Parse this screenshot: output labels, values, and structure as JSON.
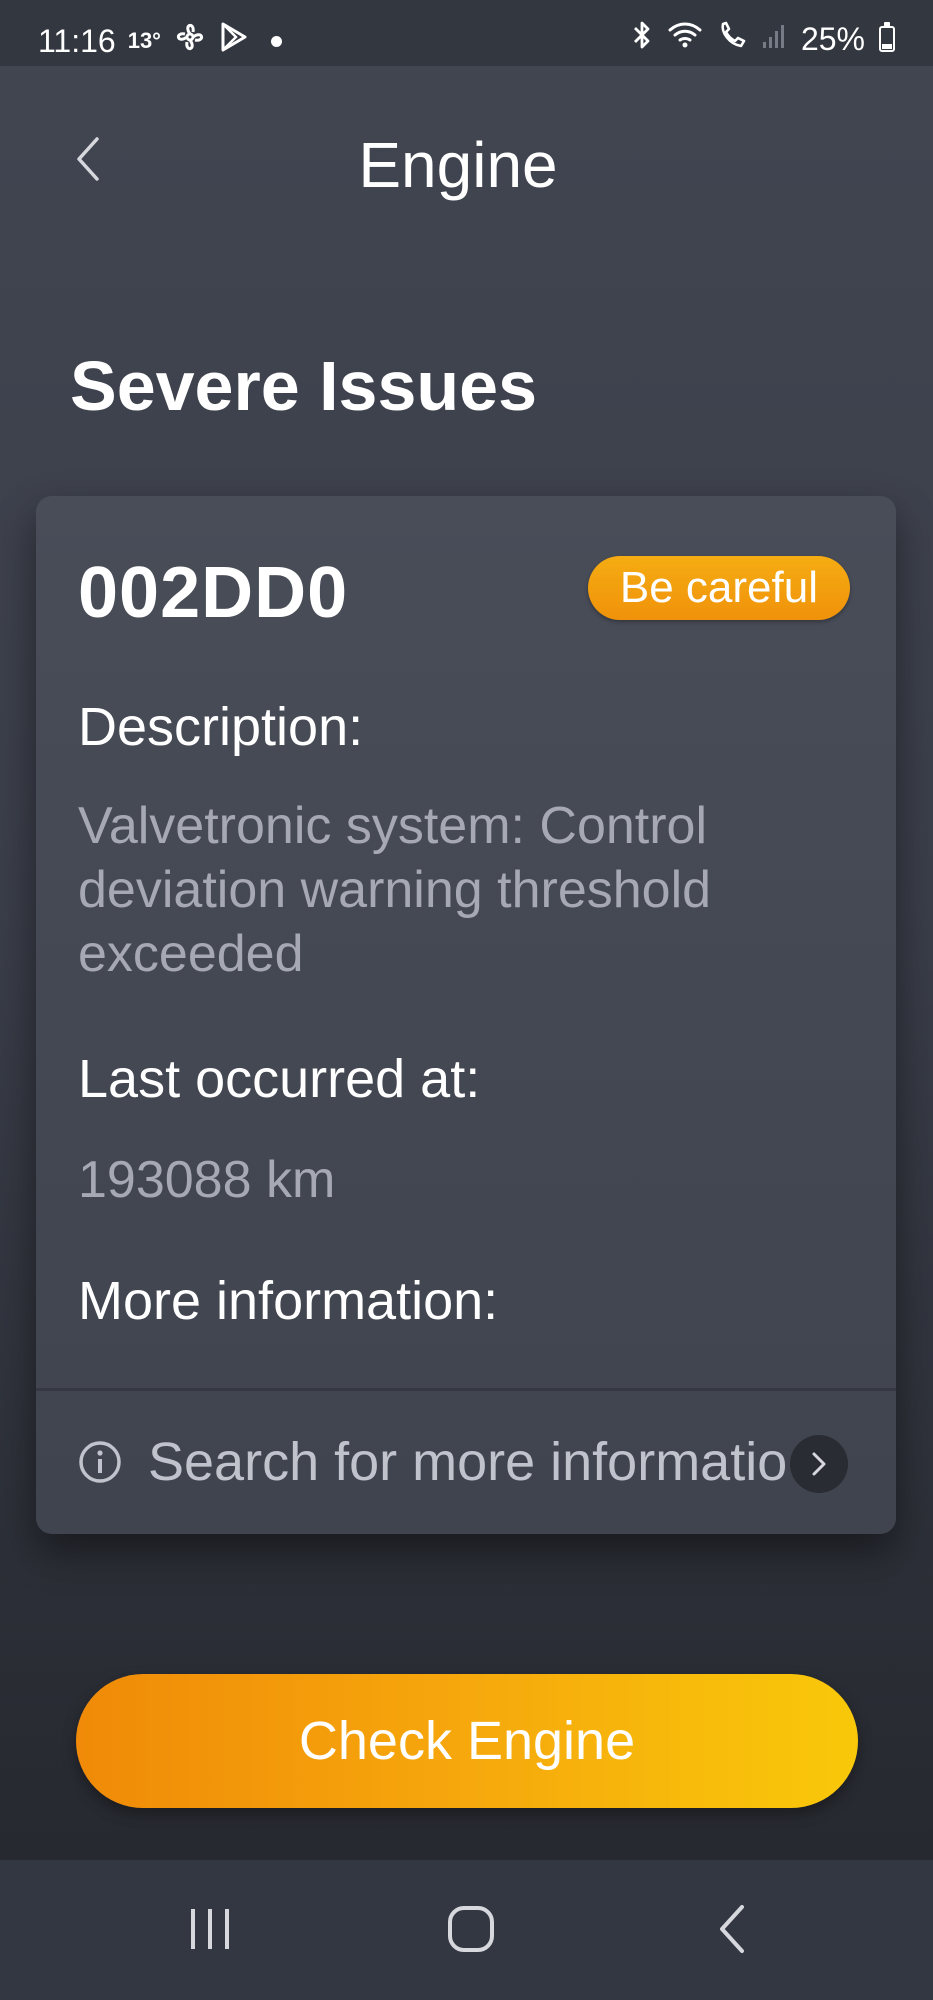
{
  "status_bar": {
    "time": "11:16",
    "temperature": "13°",
    "battery": "25%",
    "icons": [
      "fan-icon",
      "play-store-icon",
      "notification-dot",
      "bluetooth-icon",
      "wifi-icon",
      "wifi-calling-icon",
      "signal-icon",
      "battery-icon"
    ]
  },
  "header": {
    "title": "Engine",
    "back_icon": "chevron-left-icon"
  },
  "section": {
    "title": "Severe Issues"
  },
  "issue": {
    "code": "002DD0",
    "severity": "Be careful",
    "description_label": "Description:",
    "description": "Valvetronic system: Control deviation warning threshold exceeded",
    "last_occurred_label": "Last occurred at:",
    "last_occurred": "193088 km",
    "more_info_label": "More information:",
    "search_text": "Search for more information"
  },
  "primary_action": {
    "label": "Check Engine"
  },
  "colors": {
    "accent": "#f6a80c",
    "background": "#3a3e49",
    "card": "#474b55",
    "muted_text": "#a6a9b3"
  },
  "nav": {
    "items": [
      "recent-apps-icon",
      "home-icon",
      "back-icon"
    ]
  }
}
